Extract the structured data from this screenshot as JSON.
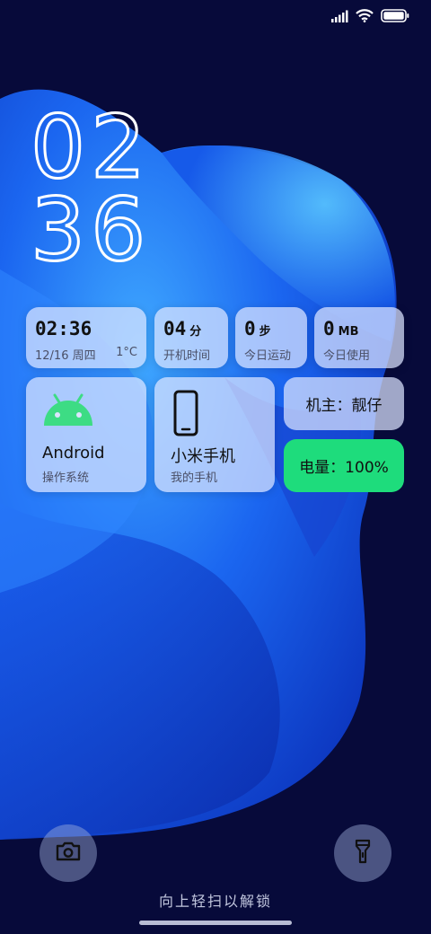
{
  "status_bar": {
    "icons": [
      "signal-icon",
      "wifi-icon",
      "battery-icon"
    ]
  },
  "clock": {
    "hour": "02",
    "minute": "36"
  },
  "widgets": {
    "time_card": {
      "time": "02:36",
      "date": "12/16 周四",
      "temp": "1°C"
    },
    "uptime_card": {
      "value": "04",
      "unit": "分",
      "label": "开机时间"
    },
    "steps_card": {
      "value": "0",
      "unit": "步",
      "label": "今日运动"
    },
    "data_card": {
      "value": "0",
      "unit": "MB",
      "label": "今日使用"
    },
    "os_card": {
      "title": "Android",
      "subtitle": "操作系统",
      "icon": "android-icon",
      "icon_color": "#3ddc84"
    },
    "phone_card": {
      "title": "小米手机",
      "subtitle": "我的手机",
      "icon": "phone-icon"
    },
    "owner_pill": {
      "label": "机主：靓仔"
    },
    "battery_pill": {
      "label": "电量：100%",
      "color": "#1edc7c"
    }
  },
  "bottom": {
    "camera_icon": "camera-icon",
    "flashlight_icon": "flashlight-icon",
    "unlock_hint": "向上轻扫以解锁"
  },
  "colors": {
    "background": "#070a3a",
    "wallpaper_blue": "#1f6fff",
    "card_bg": "#dce4ff"
  }
}
